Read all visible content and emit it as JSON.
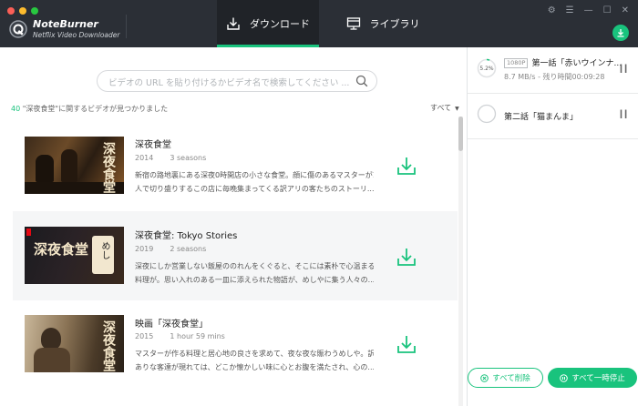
{
  "app": {
    "name": "NoteBurner",
    "subtitle": "Netflix Video Downloader"
  },
  "colors": {
    "accent": "#19c37d",
    "titlebar": "#2b2f36",
    "traffic": [
      "#fb5f57",
      "#fdbc2e",
      "#28c840"
    ]
  },
  "tabs": {
    "download": "ダウンロード",
    "library": "ライブラリ"
  },
  "search": {
    "placeholder": "ビデオの URL を貼り付けるかビデオ名で検索してください ..."
  },
  "results": {
    "count": "40",
    "text": " \"深夜食堂\"に関するビデオが見つかりました",
    "filter": "すべて",
    "items": [
      {
        "title": "深夜食堂",
        "year": "2014",
        "info": "3 seasons",
        "desc1": "新宿の路地裏にある深夜0時開店の小さな食堂。顔に傷のあるマスターが1",
        "desc2": "人で切り盛りするこの店に毎晩集まってくる訳アリの客たちのストーリ...",
        "thumb_text": "深夜食堂"
      },
      {
        "title": "深夜食堂: Tokyo Stories",
        "year": "2019",
        "info": "2 seasons",
        "desc1": "深夜にしか営業しない飯屋ののれんをくぐると、そこには素朴で心温まる",
        "desc2": "料理が。思い入れのある一皿に添えられた物語が、めしやに集う人々の...",
        "thumb_text": "深夜食堂",
        "thumb_text2": "めし"
      },
      {
        "title": "映画「深夜食堂」",
        "year": "2015",
        "info": "1 hour 59 mins",
        "desc1": "マスターが作る料理と居心地の良さを求めて、夜な夜な賑わうめしや。訳",
        "desc2": "ありな客達が現れては、どこか懐かしい味に心とお腹を満たされ、心の...",
        "thumb_text": "深夜食堂"
      }
    ]
  },
  "queue": {
    "tasks": [
      {
        "quality": "1080P",
        "title": "第一話「赤いウインナ...",
        "progress_text": "5.2%",
        "progress": 0.052,
        "speed": "8.7 MB/s - 残り時間00:09:28"
      },
      {
        "title": "第二話「猫まんま」"
      }
    ],
    "delete_all": "すべて削除",
    "pause_all": "すべて一時停止"
  }
}
